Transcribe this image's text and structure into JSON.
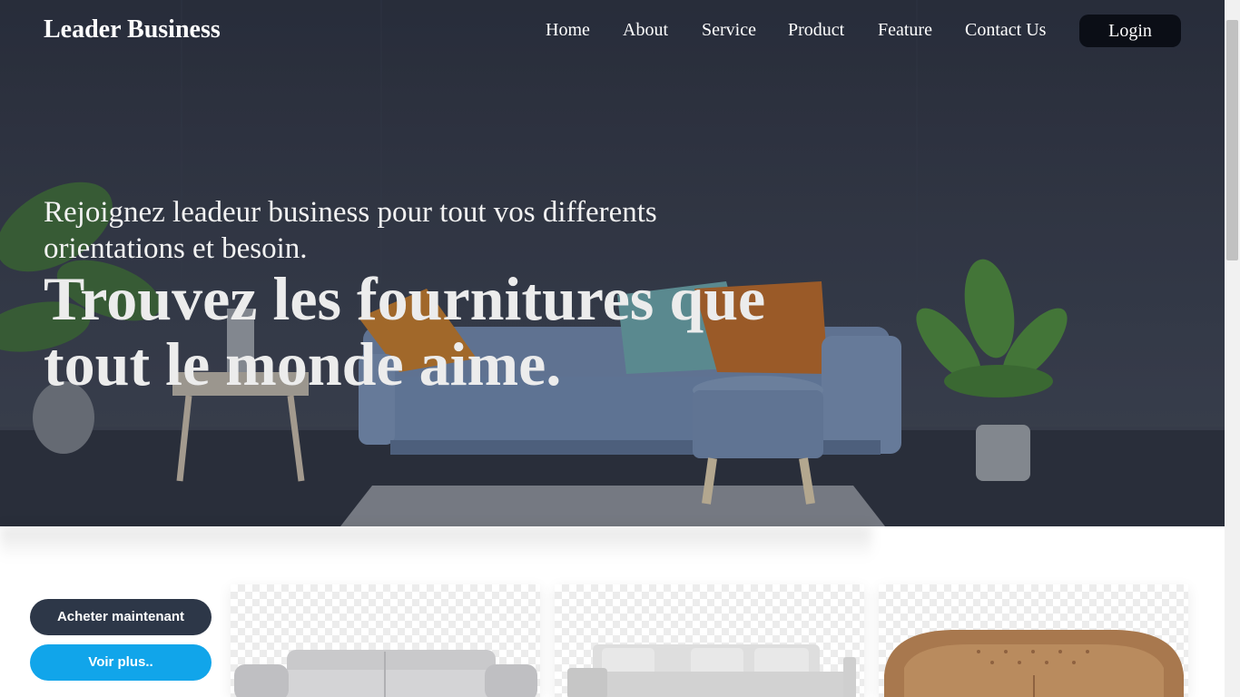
{
  "header": {
    "brand": "Leader Business",
    "nav": [
      {
        "label": "Home"
      },
      {
        "label": "About"
      },
      {
        "label": "Service"
      },
      {
        "label": "Product"
      },
      {
        "label": "Feature"
      },
      {
        "label": "Contact Us"
      }
    ],
    "login_label": "Login"
  },
  "hero": {
    "subtitle": "Rejoignez leadeur business pour tout vos differents orientations et besoin.",
    "title": "Trouvez les fournitures que tout le monde aime.",
    "image": "living-room-blue-sofa-photo"
  },
  "actions": {
    "buy_label": "Acheter maintenant",
    "more_label": "Voir plus.."
  },
  "products": [
    {
      "image": "grey-leather-sofa"
    },
    {
      "image": "light-grey-sectional-sofa"
    },
    {
      "image": "tan-chesterfield-sofa"
    }
  ],
  "colors": {
    "login_bg": "#0b0e16",
    "buy_button": "#2d3748",
    "more_button": "#11a5ea"
  }
}
